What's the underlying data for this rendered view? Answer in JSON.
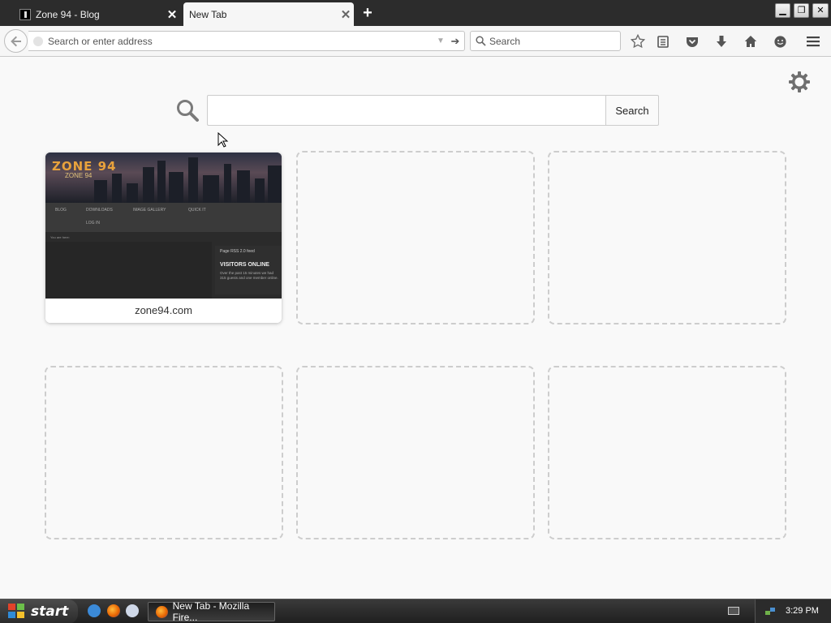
{
  "browser": {
    "tabs": [
      {
        "label": "Zone 94 - Blog",
        "active": false
      },
      {
        "label": "New Tab",
        "active": true
      }
    ],
    "url_placeholder": "Search or enter address",
    "search_placeholder": "Search"
  },
  "newtab": {
    "search_button_label": "Search",
    "tiles": [
      {
        "title": "zone94.com",
        "has_thumbnail": true
      },
      {
        "title": "",
        "has_thumbnail": false
      },
      {
        "title": "",
        "has_thumbnail": false
      },
      {
        "title": "",
        "has_thumbnail": false
      },
      {
        "title": "",
        "has_thumbnail": false
      },
      {
        "title": "",
        "has_thumbnail": false
      }
    ],
    "thumbnail": {
      "logo": "ZONE 94",
      "logo_sub": "ZONE 94",
      "nav": [
        "BLOG",
        "DOWNLOADS",
        "IMAGE GALLERY",
        "QUICK IT",
        "LOG IN"
      ],
      "crumb": "You are here:",
      "feed": "Page RSS 2.0 feed",
      "sidebar_title": "VISITORS ONLINE",
      "sidebar_text": "Over the past 15 minutes we had 315 guests and one member online."
    }
  },
  "taskbar": {
    "start_label": "start",
    "window_label": "New Tab - Mozilla Fire...",
    "clock": "3:29 PM"
  },
  "colors": {
    "tab_strip": "#2c2c2c",
    "toolbar": "#f6f6f6",
    "page_bg": "#f9f9f9",
    "tile_border": "#cdcdcd",
    "taskbar": "#2a2a2a"
  }
}
